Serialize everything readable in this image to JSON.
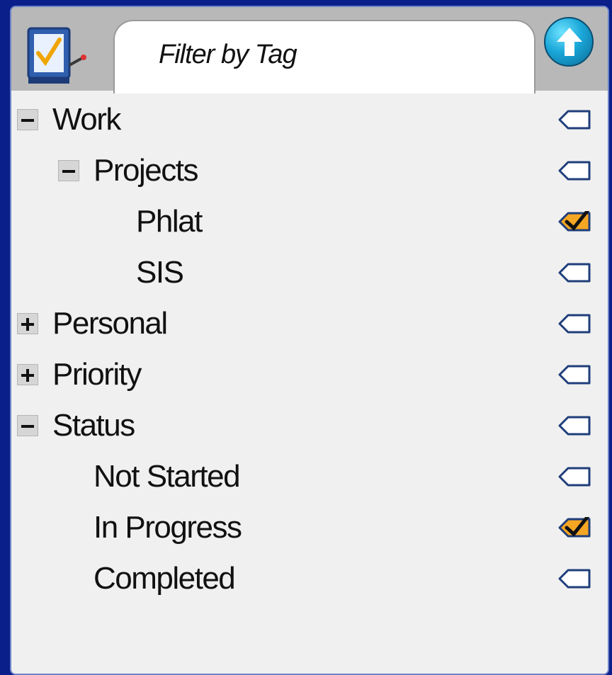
{
  "header": {
    "tab_label": "Filter by Tag"
  },
  "icons": {
    "app": "tasks-checklist-icon",
    "up": "up-arrow-icon",
    "tag_empty": "tag-icon",
    "tag_checked": "tag-checked-icon"
  },
  "colors": {
    "background": "#0a1f8a",
    "tag_checked_fill": "#f5a623"
  },
  "tree": {
    "items": [
      {
        "label": "Work",
        "level": 0,
        "toggle": "minus",
        "tagged": false
      },
      {
        "label": "Projects",
        "level": 1,
        "toggle": "minus",
        "tagged": false
      },
      {
        "label": "Phlat",
        "level": 2,
        "toggle": "none",
        "tagged": true
      },
      {
        "label": "SIS",
        "level": 2,
        "toggle": "none",
        "tagged": false
      },
      {
        "label": "Personal",
        "level": 0,
        "toggle": "plus",
        "tagged": false
      },
      {
        "label": "Priority",
        "level": 0,
        "toggle": "plus",
        "tagged": false
      },
      {
        "label": "Status",
        "level": 0,
        "toggle": "minus",
        "tagged": false
      },
      {
        "label": "Not Started",
        "level": 1,
        "toggle": "none",
        "tagged": false
      },
      {
        "label": "In Progress",
        "level": 1,
        "toggle": "none",
        "tagged": true
      },
      {
        "label": "Completed",
        "level": 1,
        "toggle": "none",
        "tagged": false
      }
    ]
  }
}
